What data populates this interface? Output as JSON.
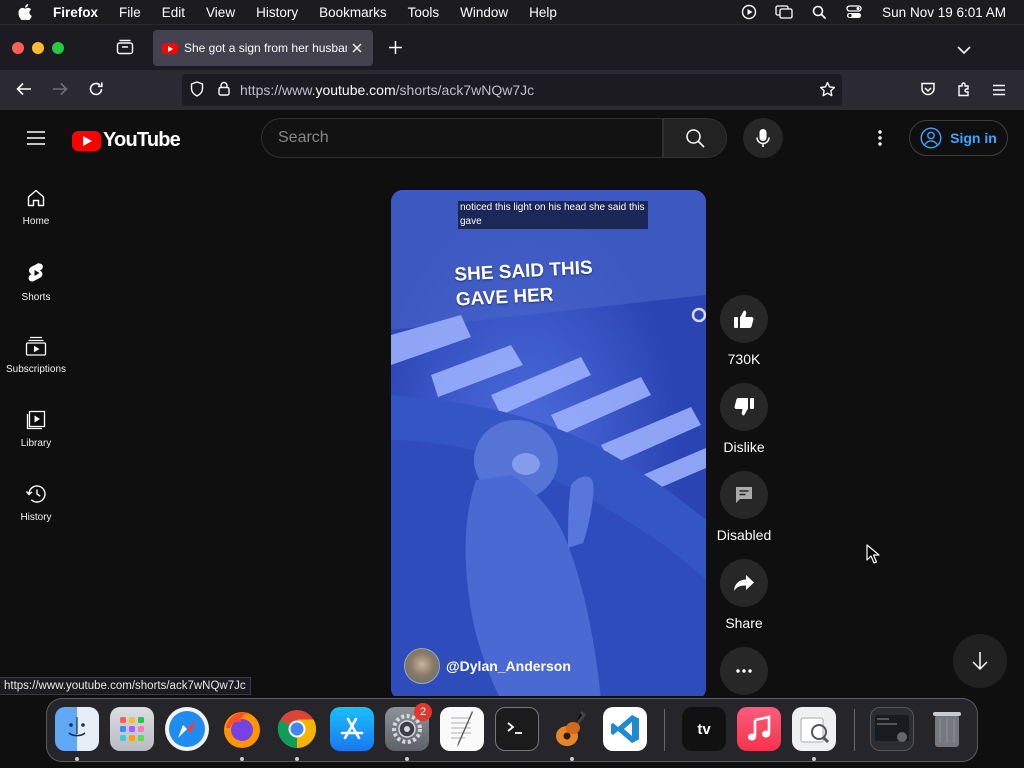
{
  "menubar": {
    "app": "Firefox",
    "items": [
      "File",
      "Edit",
      "View",
      "History",
      "Bookmarks",
      "Tools",
      "Window",
      "Help"
    ],
    "clock": "Sun Nov 19  6:01 AM"
  },
  "browser": {
    "tab_title": "She got a sign from her husband",
    "url_prefix": "https://www.",
    "url_domain": "youtube.com",
    "url_path": "/shorts/ack7wNQw7Jc",
    "status_url": "https://www.youtube.com/shorts/ack7wNQw7Jc"
  },
  "youtube": {
    "logo_text": "YouTube",
    "search_placeholder": "Search",
    "sign_in": "Sign in",
    "sidebar": [
      {
        "label": "Home",
        "icon": "home-icon"
      },
      {
        "label": "Shorts",
        "icon": "shorts-icon"
      },
      {
        "label": "Subscriptions",
        "icon": "subscriptions-icon"
      },
      {
        "label": "Library",
        "icon": "library-icon"
      },
      {
        "label": "History",
        "icon": "history-icon"
      }
    ],
    "video": {
      "caption_small": "noticed this light on his head she said this gave",
      "caption_big": "SHE SAID THIS GAVE HER",
      "channel": "@Dylan_Anderson"
    },
    "actions": {
      "like": "730K",
      "dislike": "Dislike",
      "comments": "Disabled",
      "share": "Share"
    }
  },
  "dock": {
    "apps": [
      "Finder",
      "Launchpad",
      "Safari",
      "Firefox",
      "Chrome",
      "App Store",
      "System Settings",
      "TextEdit",
      "Terminal",
      "GarageBand",
      "Visual Studio Code",
      "Apple TV",
      "Music",
      "Preview",
      "Screenshot",
      "Trash"
    ],
    "settings_badge": "2"
  },
  "colors": {
    "yt_red": "#ff0000",
    "link_blue": "#3ea6ff",
    "page_bg": "#0f0f0f"
  }
}
